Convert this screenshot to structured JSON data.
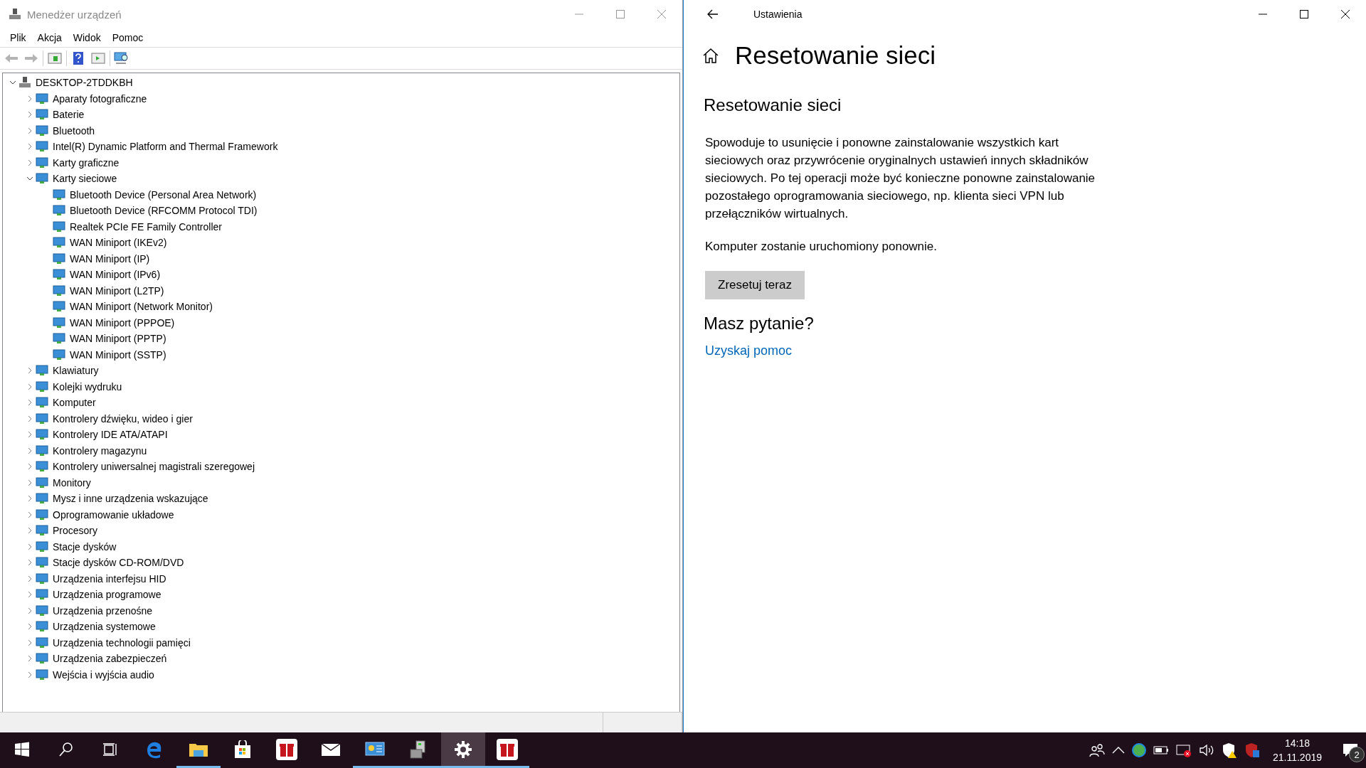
{
  "device_manager": {
    "title": "Menedżer urządzeń",
    "menu": [
      "Plik",
      "Akcja",
      "Widok",
      "Pomoc"
    ],
    "toolbar": [
      {
        "kind": "back",
        "disabled": true
      },
      {
        "kind": "forward",
        "disabled": true
      },
      {
        "kind": "sep"
      },
      {
        "kind": "tree"
      },
      {
        "kind": "sep"
      },
      {
        "kind": "help"
      },
      {
        "kind": "pane"
      },
      {
        "kind": "sep"
      },
      {
        "kind": "scan"
      }
    ],
    "tree": {
      "label": "DESKTOP-2TDDKBH",
      "expanded": true,
      "children": [
        {
          "label": "Aparaty fotograficzne",
          "expanded": false
        },
        {
          "label": "Baterie",
          "expanded": false
        },
        {
          "label": "Bluetooth",
          "expanded": false
        },
        {
          "label": "Intel(R) Dynamic Platform and Thermal Framework",
          "expanded": false
        },
        {
          "label": "Karty graficzne",
          "expanded": false
        },
        {
          "label": "Karty sieciowe",
          "expanded": true,
          "children": [
            {
              "label": "Bluetooth Device (Personal Area Network)"
            },
            {
              "label": "Bluetooth Device (RFCOMM Protocol TDI)"
            },
            {
              "label": "Realtek PCIe FE Family Controller"
            },
            {
              "label": "WAN Miniport (IKEv2)"
            },
            {
              "label": "WAN Miniport (IP)"
            },
            {
              "label": "WAN Miniport (IPv6)"
            },
            {
              "label": "WAN Miniport (L2TP)"
            },
            {
              "label": "WAN Miniport (Network Monitor)"
            },
            {
              "label": "WAN Miniport (PPPOE)"
            },
            {
              "label": "WAN Miniport (PPTP)"
            },
            {
              "label": "WAN Miniport (SSTP)"
            }
          ]
        },
        {
          "label": "Klawiatury",
          "expanded": false
        },
        {
          "label": "Kolejki wydruku",
          "expanded": false
        },
        {
          "label": "Komputer",
          "expanded": false
        },
        {
          "label": "Kontrolery dźwięku, wideo i gier",
          "expanded": false
        },
        {
          "label": "Kontrolery IDE ATA/ATAPI",
          "expanded": false
        },
        {
          "label": "Kontrolery magazynu",
          "expanded": false
        },
        {
          "label": "Kontrolery uniwersalnej magistrali szeregowej",
          "expanded": false
        },
        {
          "label": "Monitory",
          "expanded": false
        },
        {
          "label": "Mysz i inne urządzenia wskazujące",
          "expanded": false
        },
        {
          "label": "Oprogramowanie układowe",
          "expanded": false
        },
        {
          "label": "Procesory",
          "expanded": false
        },
        {
          "label": "Stacje dysków",
          "expanded": false
        },
        {
          "label": "Stacje dysków CD-ROM/DVD",
          "expanded": false
        },
        {
          "label": "Urządzenia interfejsu HID",
          "expanded": false
        },
        {
          "label": "Urządzenia programowe",
          "expanded": false
        },
        {
          "label": "Urządzenia przenośne",
          "expanded": false
        },
        {
          "label": "Urządzenia systemowe",
          "expanded": false
        },
        {
          "label": "Urządzenia technologii pamięci",
          "expanded": false
        },
        {
          "label": "Urządzenia zabezpieczeń",
          "expanded": false
        },
        {
          "label": "Wejścia i wyjścia audio",
          "expanded": false
        }
      ]
    }
  },
  "settings": {
    "title": "Ustawienia",
    "page_title": "Resetowanie sieci",
    "section_title": "Resetowanie sieci",
    "description": "Spowoduje to usunięcie i ponowne zainstalowanie wszystkich kart sieciowych oraz przywrócenie oryginalnych ustawień innych składników sieciowych. Po tej operacji może być konieczne ponowne zainstalowanie pozostałego oprogramowania sieciowego, np. klienta sieci VPN lub przełączników wirtualnych.",
    "note": "Komputer zostanie uruchomiony ponownie.",
    "button": "Zresetuj teraz",
    "help_title": "Masz pytanie?",
    "help_link": "Uzyskaj pomoc"
  },
  "taskbar": {
    "apps": [
      {
        "kind": "start",
        "running": false,
        "selected": false
      },
      {
        "kind": "search",
        "running": false,
        "selected": false
      },
      {
        "kind": "taskview",
        "running": false,
        "selected": false
      },
      {
        "kind": "edge",
        "running": false,
        "selected": false
      },
      {
        "kind": "explorer",
        "running": true,
        "selected": false
      },
      {
        "kind": "store",
        "running": false,
        "selected": false
      },
      {
        "kind": "gift",
        "running": false,
        "selected": false
      },
      {
        "kind": "mail",
        "running": false,
        "selected": false
      },
      {
        "kind": "panel",
        "running": true,
        "selected": false
      },
      {
        "kind": "devmgr",
        "running": true,
        "selected": false
      },
      {
        "kind": "settings",
        "running": true,
        "selected": true
      },
      {
        "kind": "gift",
        "running": true,
        "selected": false
      }
    ],
    "time": "14:18",
    "date": "21.11.2019",
    "notifications": "2"
  }
}
